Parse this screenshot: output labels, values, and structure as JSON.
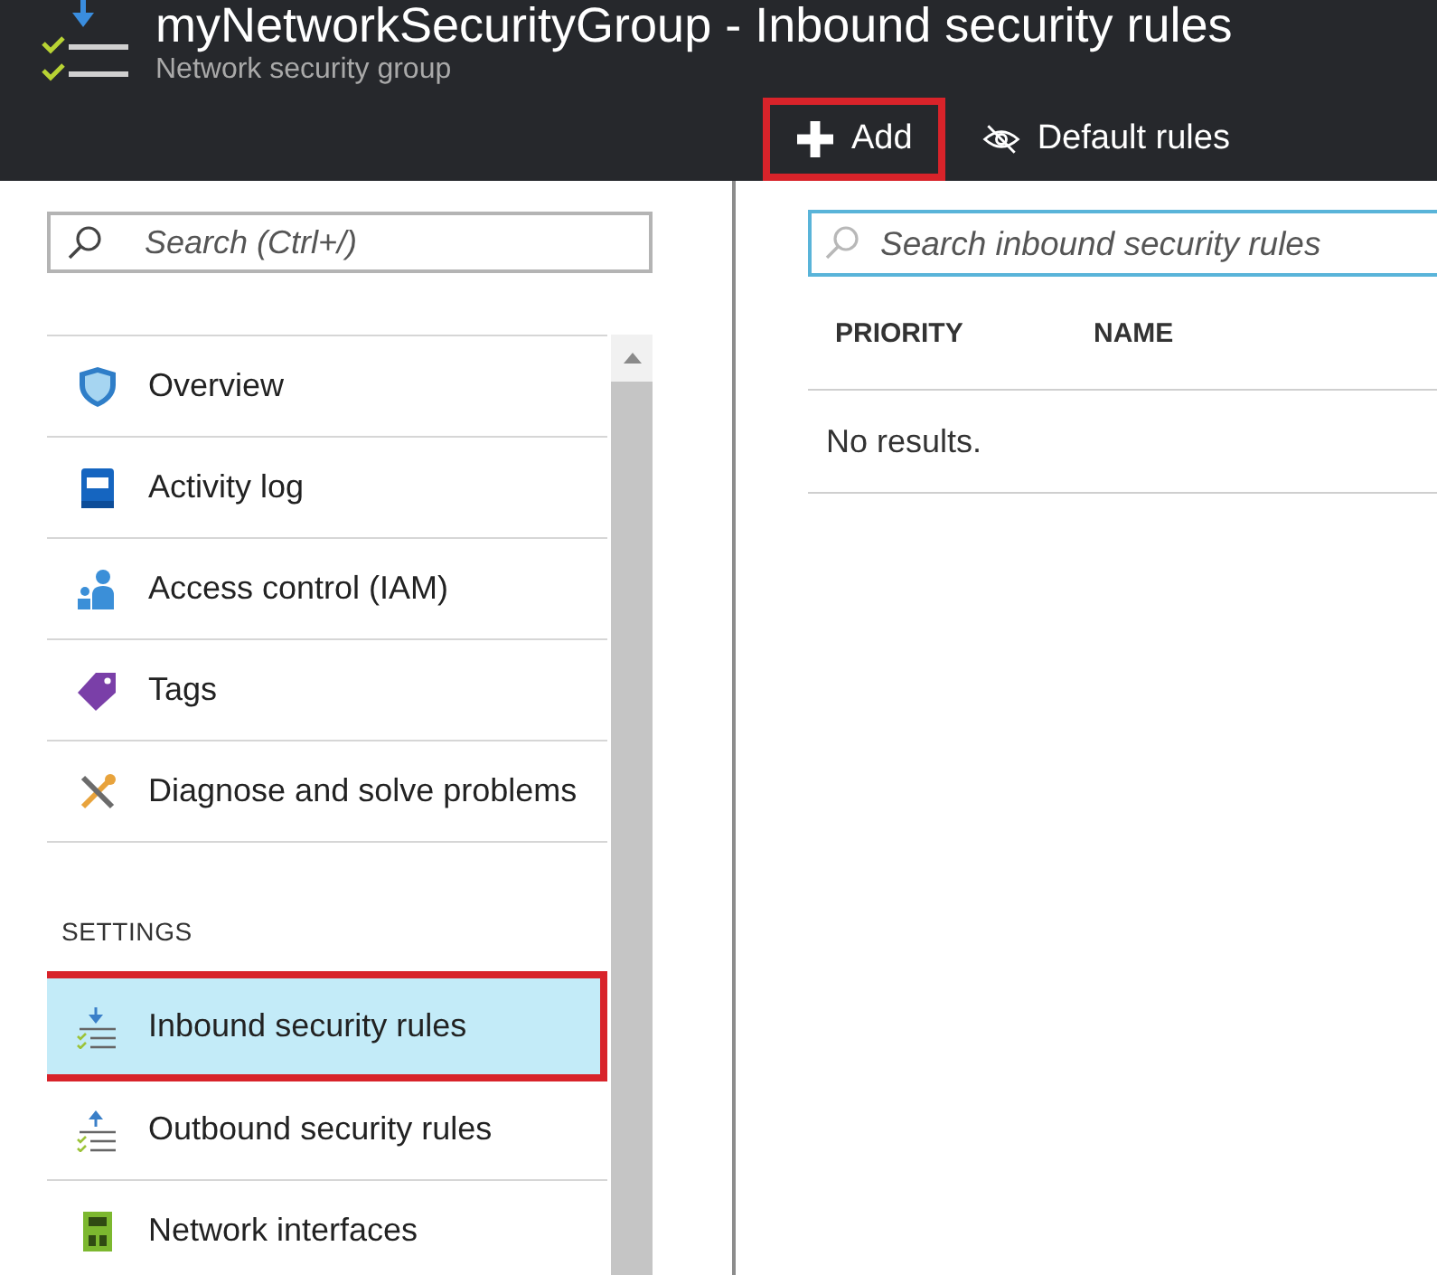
{
  "header": {
    "title": "myNetworkSecurityGroup - Inbound security rules",
    "subtitle": "Network security group"
  },
  "toolbar": [
    {
      "label": "Add",
      "highlighted": true
    },
    {
      "label": "Default rules",
      "highlighted": false
    }
  ],
  "sidebar": {
    "search": {
      "placeholder": "Search (Ctrl+/)"
    },
    "sections": [
      {
        "items": [
          {
            "label": "Overview",
            "selected": false,
            "highlighted": false
          },
          {
            "label": "Activity log",
            "selected": false,
            "highlighted": false
          },
          {
            "label": "Access control (IAM)",
            "selected": false,
            "highlighted": false
          },
          {
            "label": "Tags",
            "selected": false,
            "highlighted": false
          },
          {
            "label": "Diagnose and solve problems",
            "selected": false,
            "highlighted": false
          }
        ]
      },
      {
        "heading": "SETTINGS",
        "items": [
          {
            "label": "Inbound security rules",
            "selected": true,
            "highlighted": true
          },
          {
            "label": "Outbound security rules",
            "selected": false,
            "highlighted": false
          },
          {
            "label": "Network interfaces",
            "selected": false,
            "highlighted": false
          }
        ]
      }
    ]
  },
  "content": {
    "search": {
      "placeholder": "Search inbound security rules"
    },
    "table": {
      "columns": [
        "PRIORITY",
        "NAME"
      ],
      "empty_message": "No results."
    }
  }
}
